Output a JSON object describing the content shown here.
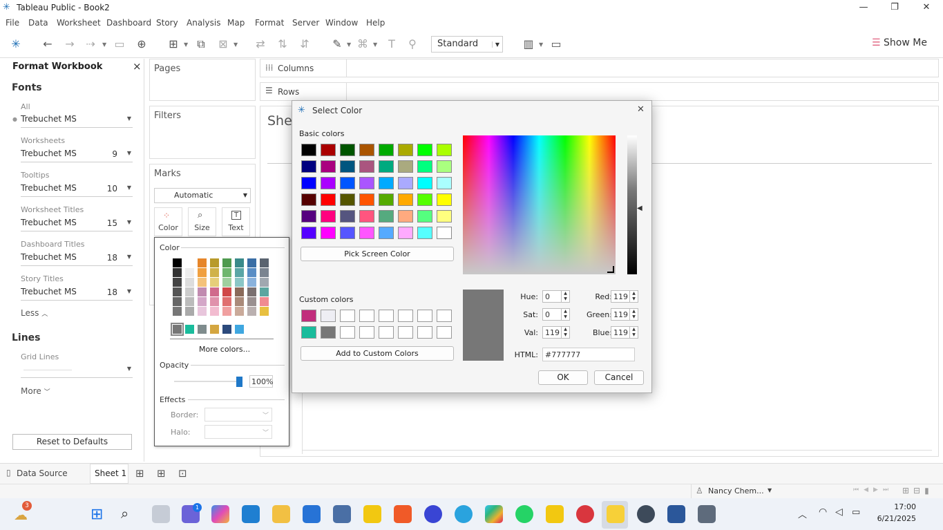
{
  "window": {
    "title": "Tableau Public - Book2",
    "minimize": "—",
    "restore": "❐",
    "close": "✕"
  },
  "menu": [
    "File",
    "Data",
    "Worksheet",
    "Dashboard",
    "Story",
    "Analysis",
    "Map",
    "Format",
    "Server",
    "Window",
    "Help"
  ],
  "toolbar": {
    "standard_label": "Standard",
    "show_me_label": "Show Me"
  },
  "format_pane": {
    "title": "Format Workbook",
    "close": "×",
    "fonts_heading": "Fonts",
    "fonts": [
      {
        "label": "All",
        "font": "Trebuchet MS",
        "size": ""
      },
      {
        "label": "Worksheets",
        "font": "Trebuchet MS",
        "size": "9"
      },
      {
        "label": "Tooltips",
        "font": "Trebuchet MS",
        "size": "10"
      },
      {
        "label": "Worksheet Titles",
        "font": "Trebuchet MS",
        "size": "15"
      },
      {
        "label": "Dashboard Titles",
        "font": "Trebuchet MS",
        "size": "18"
      },
      {
        "label": "Story Titles",
        "font": "Trebuchet MS",
        "size": "18"
      }
    ],
    "less_label": "Less",
    "lines_heading": "Lines",
    "grid_lines_label": "Grid Lines",
    "more_label": "More",
    "reset_label": "Reset to Defaults"
  },
  "shelves": {
    "pages": "Pages",
    "filters": "Filters",
    "marks": "Marks",
    "columns": "Columns",
    "rows": "Rows",
    "sheet_title": "Shee"
  },
  "marks": {
    "type": "Automatic",
    "color": "Color",
    "size": "Size",
    "text": "Text"
  },
  "color_popup": {
    "heading": "Color",
    "more_colors": "More colors...",
    "opacity_heading": "Opacity",
    "opacity_value": "100%",
    "opacity_fraction": 1.0,
    "effects_heading": "Effects",
    "border_label": "Border:",
    "halo_label": "Halo:"
  },
  "dialog": {
    "title": "Select Color",
    "close": "✕",
    "basic_colors_label": "Basic colors",
    "basic_colors": [
      "#000000",
      "#aa0000",
      "#005500",
      "#aa5500",
      "#00aa00",
      "#aaaa00",
      "#00ff00",
      "#aaff00",
      "#00007f",
      "#aa007f",
      "#00557f",
      "#aa557f",
      "#00aa7f",
      "#aaaa7f",
      "#00ff7f",
      "#aaff7f",
      "#0000ff",
      "#aa00ff",
      "#0055ff",
      "#aa55ff",
      "#00aaff",
      "#aaaaff",
      "#00ffff",
      "#aaffff",
      "#550000",
      "#ff0000",
      "#555500",
      "#ff5500",
      "#55aa00",
      "#ffaa00",
      "#55ff00",
      "#ffff00",
      "#55007f",
      "#ff007f",
      "#55557f",
      "#ff557f",
      "#55aa7f",
      "#ffaa7f",
      "#55ff7f",
      "#ffff7f",
      "#5500ff",
      "#ff00ff",
      "#5555ff",
      "#ff55ff",
      "#55aaff",
      "#ffaaff",
      "#55ffff",
      "#ffffff"
    ],
    "pick_screen_label": "Pick Screen Color",
    "custom_colors_label": "Custom colors",
    "custom_colors": [
      "#c12d7c",
      "#eeeef4",
      "#ffffff",
      "#ffffff",
      "#ffffff",
      "#ffffff",
      "#ffffff",
      "#ffffff",
      "#1abc9c",
      "#777777",
      "#ffffff",
      "#ffffff",
      "#ffffff",
      "#ffffff",
      "#ffffff",
      "#ffffff"
    ],
    "add_custom_label": "Add to Custom Colors",
    "current_color": "#777777",
    "hue_label": "Hue:",
    "hue": "0",
    "sat_label": "Sat:",
    "sat": "0",
    "val_label": "Val:",
    "val": "119",
    "red_label": "Red:",
    "red": "119",
    "green_label": "Green:",
    "green": "119",
    "blue_label": "Blue:",
    "blue": "119",
    "html_label": "HTML:",
    "html": "#777777",
    "ok_label": "OK",
    "cancel_label": "Cancel"
  },
  "tabs": {
    "data_source": "Data Source",
    "sheet1": "Sheet 1"
  },
  "status": {
    "user": "Nancy Chem..."
  },
  "taskbar": {
    "time": "17:00",
    "date": "6/21/2025",
    "weather_badge": "3",
    "chat_badge": "1"
  }
}
